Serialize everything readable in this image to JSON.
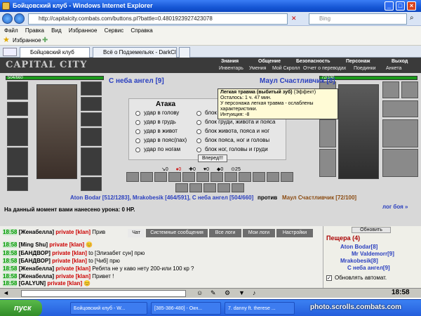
{
  "window": {
    "title": "Бойцовский клуб - Windows Internet Explorer"
  },
  "address": {
    "url": "http://capitalcity.combats.com/buttons.pl?battle=0.4801923927423078",
    "search_placeholder": "Bing"
  },
  "menu": [
    "Файл",
    "Правка",
    "Вид",
    "Избранное",
    "Сервис",
    "Справка"
  ],
  "favorites": {
    "label": "Избранное"
  },
  "tabs": [
    {
      "label": "Бойцовский клуб",
      "active": true
    },
    {
      "label": "Всё о Подземельях - DarkCl...",
      "active": false
    }
  ],
  "game": {
    "logo": "CAPITAL CITY",
    "top_nav": [
      "Знания",
      "Общение",
      "Безопасность",
      "Персонаж",
      "Выход"
    ],
    "sub_nav": [
      "Инвентарь",
      "Умения",
      "Мой Скролл",
      "Отчет о переводах",
      "Поединки",
      "Анкета"
    ],
    "left_hp": "504/660",
    "right_hp": "72/100",
    "left_name": "С неба ангел [9]",
    "right_name": "Маул Счастливчик [8]",
    "attack": {
      "title": "Атака",
      "attack_options": [
        "удар в голову",
        "удар в грудь",
        "удар в живот",
        "удар в пояс(пах)",
        "удар по ногам"
      ],
      "block_options": [
        "блок",
        "блок груди, живота и пояса",
        "блок живота, пояса и ног",
        "блок пояса, ног и головы",
        "блок ног, головы и груди"
      ],
      "submit": "Вперед!!!"
    },
    "tooltip": {
      "title": "Легкая травма (выбитый зуб)",
      "effect": " (Эффект)",
      "lines": [
        "Осталось: 1 ч. 47 мин.",
        "У персонажа легкая травма - ослаблены",
        "характеристики.",
        "Интуиция: -8"
      ]
    },
    "stats": [
      "0",
      "0",
      "0",
      "0",
      "0",
      "25"
    ],
    "fight": {
      "team_left": "Aton Bodar [512/1283], Mrakobesik [464/591], С неба ангел [504/660]",
      "versus": "против",
      "team_right": "Маул Счастливчик [72/100]",
      "log_link": "лог боя »"
    },
    "damage_text": "На данный момент вами нанесено урона: 0 HP."
  },
  "chat": {
    "tabs": [
      "Чат",
      "Системные сообщения",
      "Все логи",
      "Мои логи",
      "Настройки"
    ],
    "lines": [
      {
        "time": "18:58",
        "nick": "[Женабелла]",
        "private": "private [klan]",
        "text": " Прив"
      },
      {
        "time": "18:58",
        "nick": "[Ming Shu]",
        "private": "private [klan]",
        "text": " 😊"
      },
      {
        "time": "18:58",
        "nick": "[БАНДВОР]",
        "private": "private [klan]",
        "text": " to [Элизабет сун] прю"
      },
      {
        "time": "18:58",
        "nick": "[БАНДВОР]",
        "private": "private [klan]",
        "text": " to [Чиб] прю"
      },
      {
        "time": "18:58",
        "nick": "[Женабелла]",
        "private": "private [klan]",
        "text": " Ребята не у каво нету 200-или 100 кр ?"
      },
      {
        "time": "18:58",
        "nick": "[Женабелла]",
        "private": "private [klan]",
        "text": " Привет !"
      },
      {
        "time": "18:58",
        "nick": "[GALYUN]",
        "private": "private [klan]",
        "text": " 😊"
      }
    ]
  },
  "room": {
    "refresh_button": "Обновить",
    "title": "Пещера (4)",
    "members": [
      "Aton Bodar[8]",
      "Mr Valdemorr[9]",
      "Mrakobesik[8]",
      "С неба ангел[9]"
    ],
    "auto_update": "Обновлять автомат."
  },
  "taskbar": {
    "start": "пуск",
    "items": [
      "Бойцовский клуб - W...",
      "[385-386-480] - Окн...",
      "7. danny ft. therese ..."
    ],
    "clock": "18:58"
  },
  "watermark": "photo.scrolls.combats.com"
}
